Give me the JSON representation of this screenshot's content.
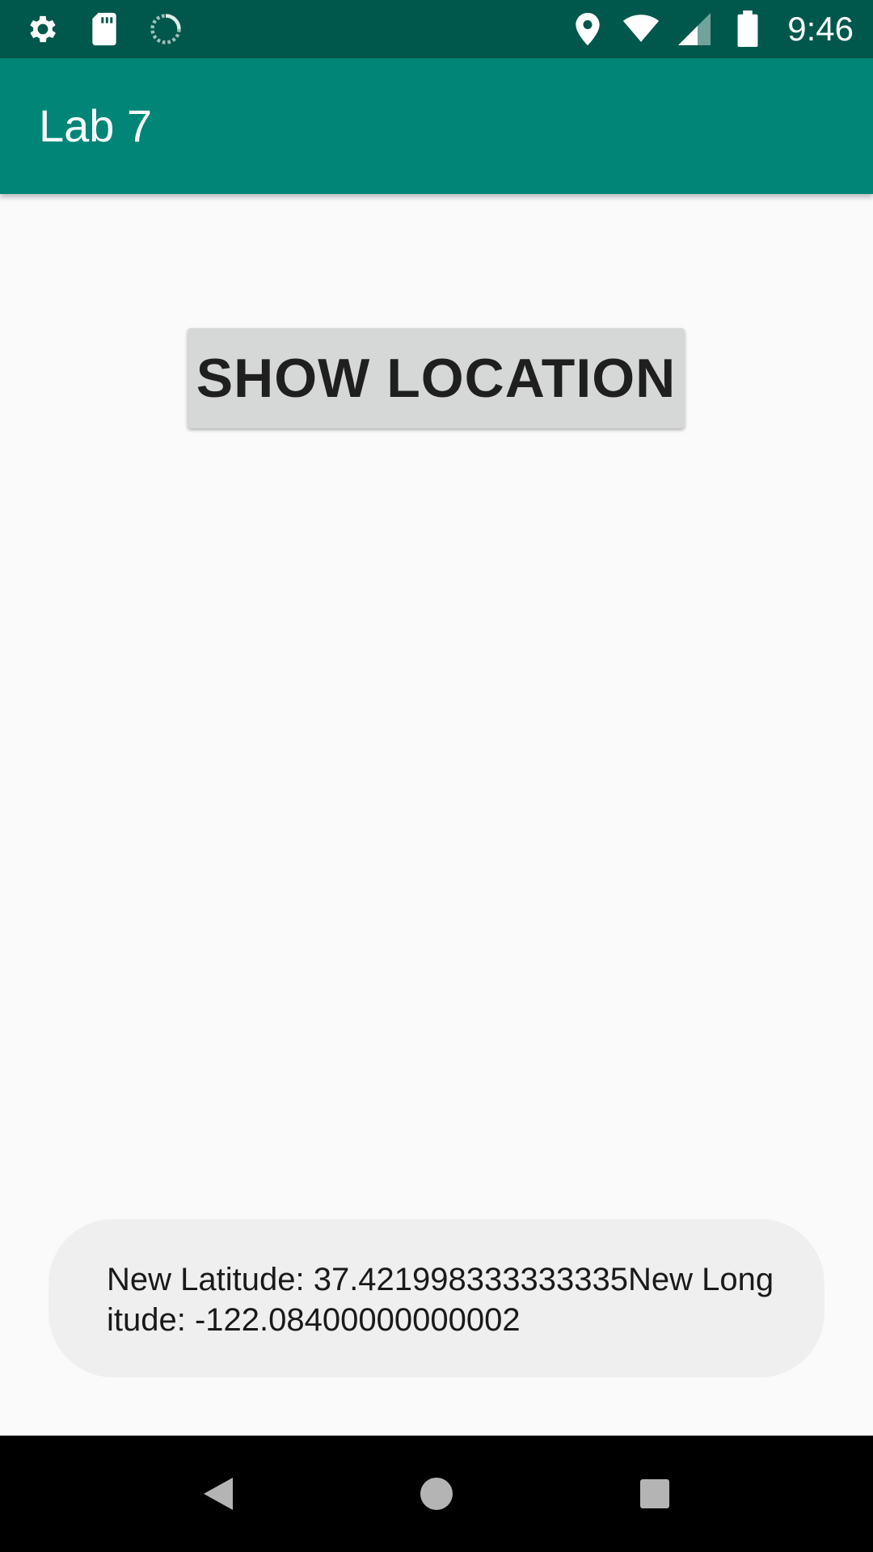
{
  "status_bar": {
    "time": "9:46",
    "left_icons": [
      "gear-icon",
      "sd-card-icon",
      "sync-icon"
    ],
    "right_icons": [
      "location-pin-icon",
      "wifi-icon",
      "signal-icon",
      "battery-icon"
    ],
    "background": "#00574b"
  },
  "app_bar": {
    "title": "Lab 7",
    "background": "#008577"
  },
  "main": {
    "show_location_label": "SHOW LOCATION"
  },
  "toast": {
    "message": "New Latitude: 37.421998333333335New Longitude: -122.08400000000002"
  },
  "nav_bar": {
    "buttons": [
      "back-icon",
      "home-icon",
      "recents-icon"
    ]
  }
}
